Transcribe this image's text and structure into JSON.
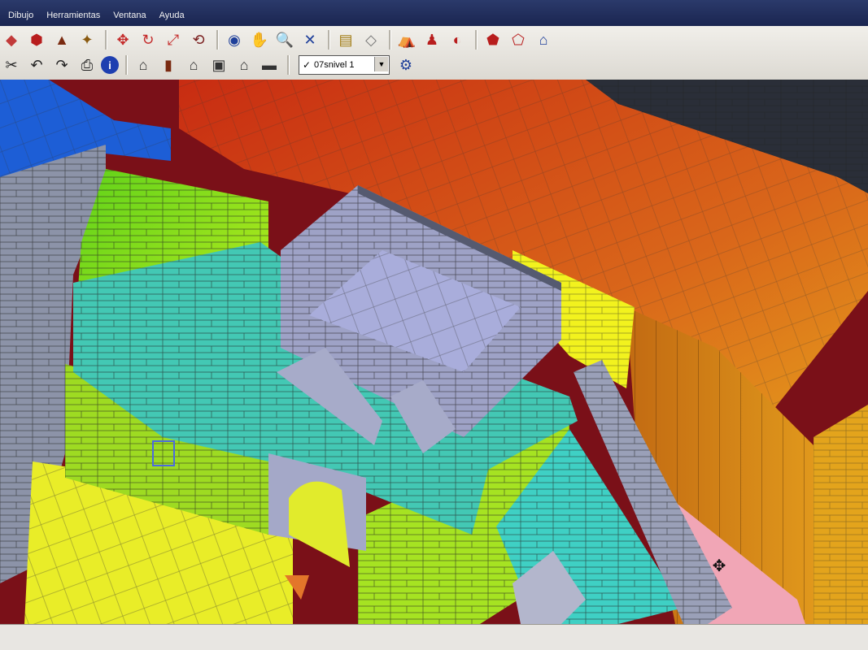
{
  "menu": {
    "items": [
      "Dibujo",
      "Herramientas",
      "Ventana",
      "Ayuda"
    ]
  },
  "toolbar_row1_icons": [
    "eraser-icon",
    "paint-bucket-icon",
    "push-pull-icon",
    "follow-me-icon",
    "move-icon",
    "rotate-icon",
    "scale-icon",
    "offset-icon",
    "orbit-icon",
    "pan-icon",
    "zoom-icon",
    "zoom-extents-icon",
    "section-plane-icon",
    "axes-icon",
    "walk-icon",
    "position-camera-icon",
    "look-around-icon",
    "components-icon",
    "get-models-icon",
    "share-model-icon"
  ],
  "toolbar_row2_icons": [
    "cut-icon",
    "undo-icon",
    "redo-icon",
    "print-icon",
    "model-info-icon",
    "iso-view-icon",
    "top-view-icon",
    "front-view-icon",
    "right-view-icon",
    "back-view-icon",
    "left-view-icon"
  ],
  "layer": {
    "current": "07snivel 1",
    "check": "✓"
  },
  "colors": {
    "menubar": "#2b3a6b",
    "toolbar": "#e8e6e2",
    "layer_select_bg": "#ffffff"
  }
}
